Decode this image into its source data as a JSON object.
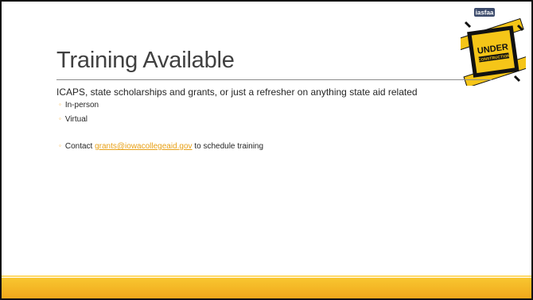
{
  "slide": {
    "title": "Training Available",
    "lead": "ICAPS, state scholarships and grants, or just a refresher on anything state aid related",
    "bullets": [
      "In-person",
      "Virtual"
    ],
    "contact": {
      "prefix": "Contact ",
      "email": "grants@iowacollegeaid.gov",
      "suffix": " to schedule training"
    }
  },
  "logo": {
    "brand": "iasfaa",
    "sign_top": "UNDER",
    "sign_bottom": "CONSTRUCTION"
  },
  "colors": {
    "accent": "#f5a31a",
    "footer": "#f8c630",
    "title": "#404040"
  }
}
